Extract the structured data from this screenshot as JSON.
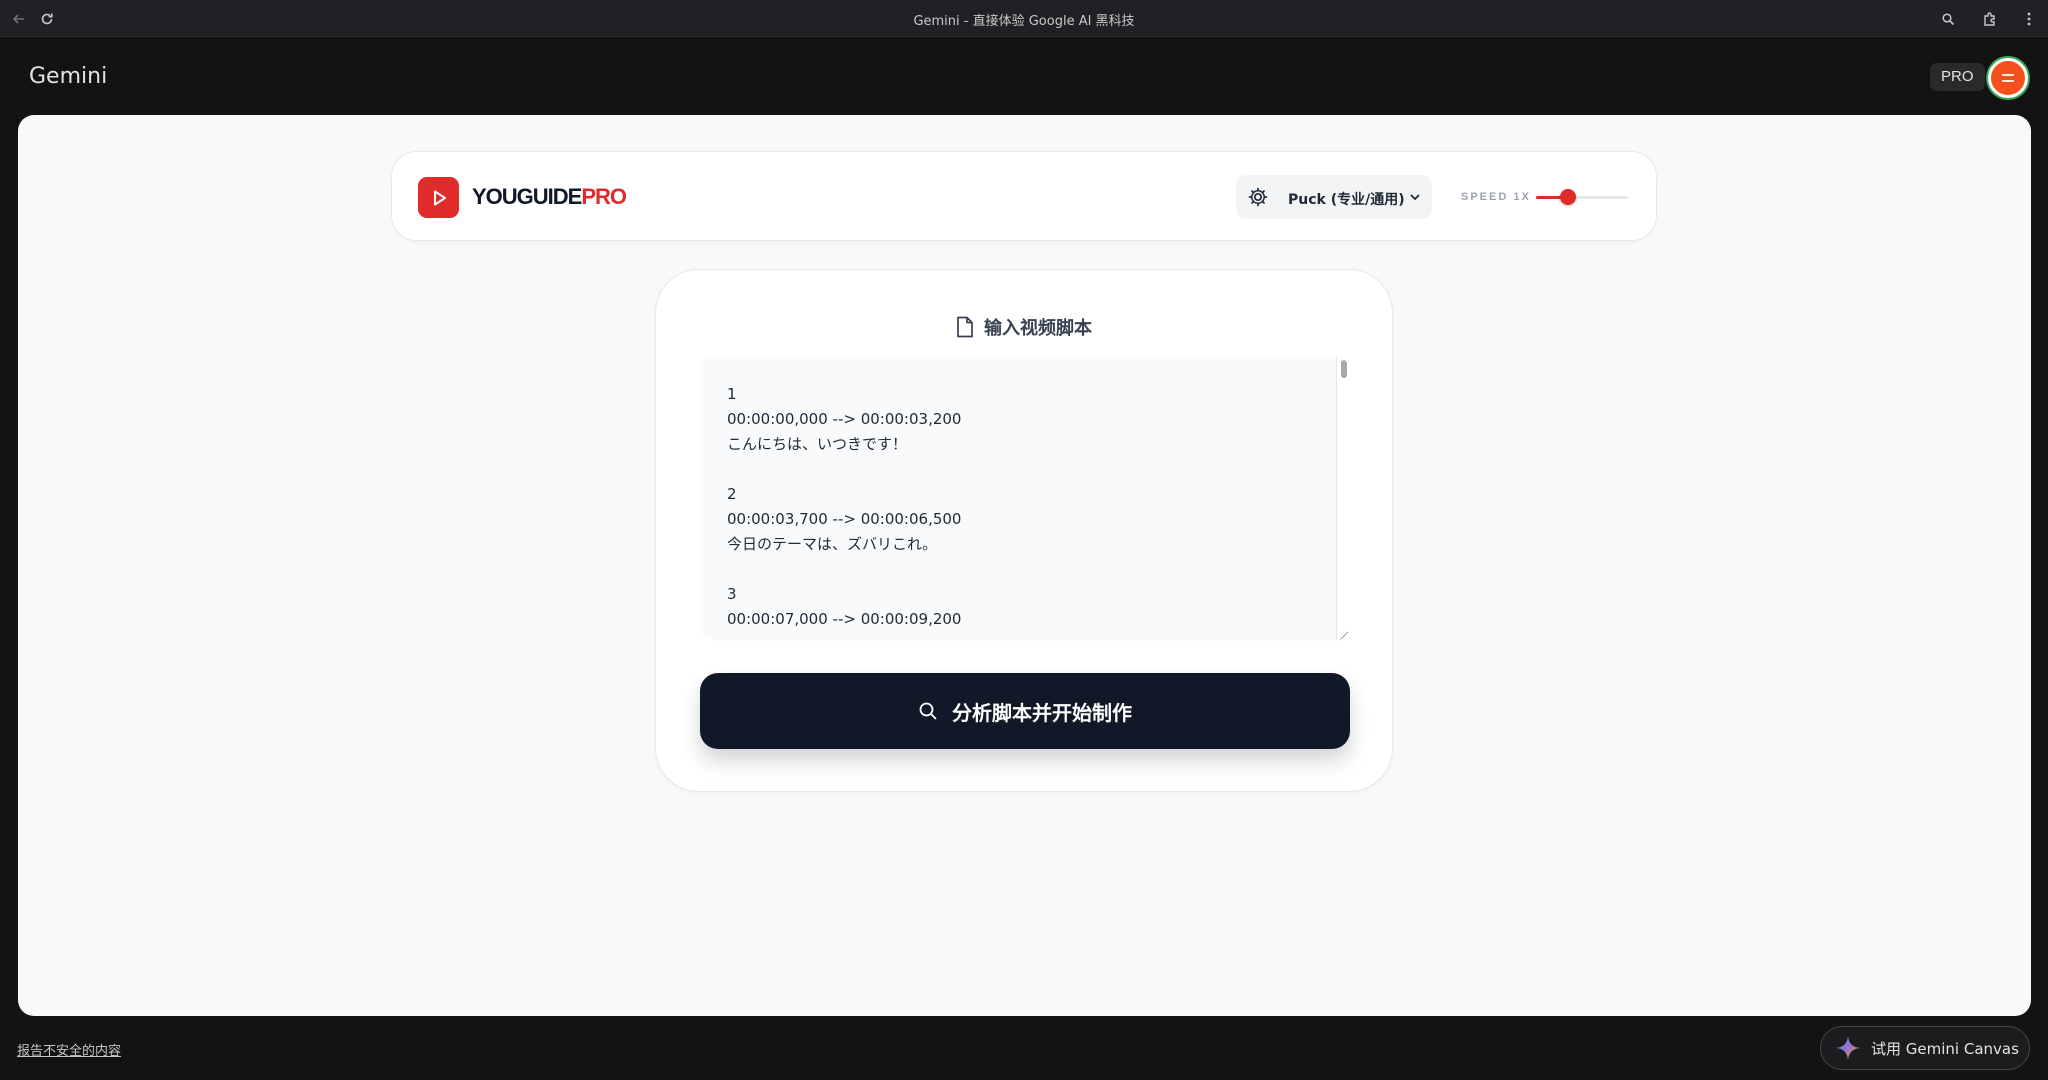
{
  "browser": {
    "title": "Gemini - 直接体验 Google AI 黑科技",
    "icons": [
      "back-arrow-icon",
      "reload-icon",
      "zoom-icon",
      "extensions-icon",
      "more-vertical-icon"
    ]
  },
  "app": {
    "name": "Gemini",
    "plan_badge": "PRO"
  },
  "header": {
    "logo_main": "YOUGUIDE",
    "logo_accent": "PRO",
    "voice_selected": "Puck (专业/通用)",
    "speed_label": "SPEED 1X",
    "speed_value": 1,
    "speed_slider_fraction": 0.35
  },
  "editor": {
    "section_title": "输入视频脚本",
    "script_text": "1\n00:00:00,000 --> 00:00:03,200\nこんにちは、いつきです！\n\n2\n00:00:03,700 --> 00:00:06,500\n今日のテーマは、ズバリこれ。\n\n3\n00:00:07,000 --> 00:00:09,200",
    "analyze_button": "分析脚本并开始制作"
  },
  "footer": {
    "report_link": "报告不安全的内容",
    "canvas_button": "试用 Gemini Canvas"
  },
  "colors": {
    "brand_red": "#e02b2b",
    "dark_button": "#111827",
    "page_bg": "#131314"
  }
}
